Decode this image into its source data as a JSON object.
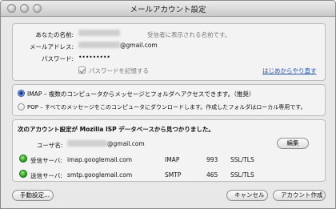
{
  "window": {
    "title": "メールアカウント設定"
  },
  "account": {
    "name_label": "あなたの名前:",
    "name_hint": "受信者に表示される名前です。",
    "email_label": "メールアドレス:",
    "email_value": "@gmail.com",
    "password_label": "パスワード:",
    "password_value": "•••••••••",
    "remember_label": "パスワードを記憶する",
    "restart_link": "はじめからやり直す"
  },
  "protocols": {
    "imap_label": "IMAP – 複数のコンピュータからメッセージとフォルダへアクセスできます。（推奨）",
    "pop_label": "POP – すべてのメッセージをこのコンピュータにダウンロードします。作成したフォルダはローカル専用です。"
  },
  "found": {
    "heading": "次のアカウント設定が Mozilla ISP データベースから見つかりました。",
    "username_label": "ユーザ名:",
    "username_value": "@gmail.com",
    "edit_button": "編集",
    "incoming": {
      "label": "受信サーバ:",
      "host": "imap.googlemail.com",
      "protocol": "IMAP",
      "port": "993",
      "security": "SSL/TLS"
    },
    "outgoing": {
      "label": "送信サーバ:",
      "host": "smtp.googlemail.com",
      "protocol": "SMTP",
      "port": "465",
      "security": "SSL/TLS"
    }
  },
  "buttons": {
    "manual": "手動設定...",
    "cancel": "キャンセル",
    "create": "アカウント作成"
  }
}
